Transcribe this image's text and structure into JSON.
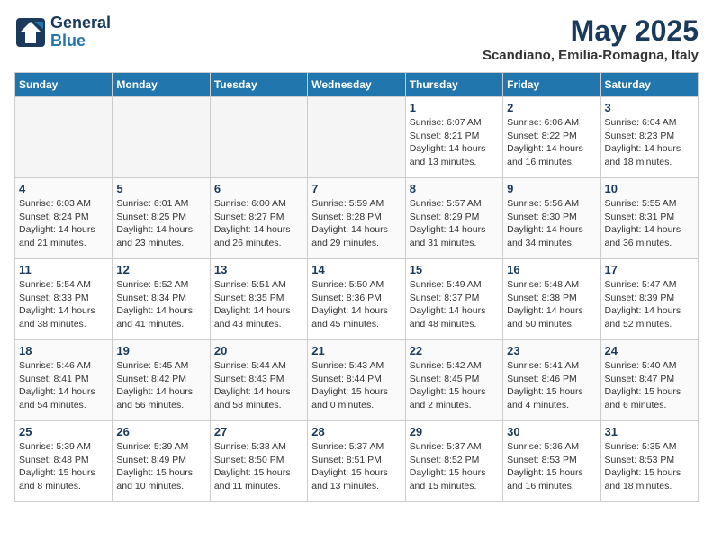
{
  "header": {
    "logo_line1": "General",
    "logo_line2": "Blue",
    "month": "May 2025",
    "location": "Scandiano, Emilia-Romagna, Italy"
  },
  "weekdays": [
    "Sunday",
    "Monday",
    "Tuesday",
    "Wednesday",
    "Thursday",
    "Friday",
    "Saturday"
  ],
  "weeks": [
    [
      {
        "day": "",
        "info": "",
        "empty": true
      },
      {
        "day": "",
        "info": "",
        "empty": true
      },
      {
        "day": "",
        "info": "",
        "empty": true
      },
      {
        "day": "",
        "info": "",
        "empty": true
      },
      {
        "day": "1",
        "info": "Sunrise: 6:07 AM\nSunset: 8:21 PM\nDaylight: 14 hours\nand 13 minutes.",
        "empty": false
      },
      {
        "day": "2",
        "info": "Sunrise: 6:06 AM\nSunset: 8:22 PM\nDaylight: 14 hours\nand 16 minutes.",
        "empty": false
      },
      {
        "day": "3",
        "info": "Sunrise: 6:04 AM\nSunset: 8:23 PM\nDaylight: 14 hours\nand 18 minutes.",
        "empty": false
      }
    ],
    [
      {
        "day": "4",
        "info": "Sunrise: 6:03 AM\nSunset: 8:24 PM\nDaylight: 14 hours\nand 21 minutes.",
        "empty": false
      },
      {
        "day": "5",
        "info": "Sunrise: 6:01 AM\nSunset: 8:25 PM\nDaylight: 14 hours\nand 23 minutes.",
        "empty": false
      },
      {
        "day": "6",
        "info": "Sunrise: 6:00 AM\nSunset: 8:27 PM\nDaylight: 14 hours\nand 26 minutes.",
        "empty": false
      },
      {
        "day": "7",
        "info": "Sunrise: 5:59 AM\nSunset: 8:28 PM\nDaylight: 14 hours\nand 29 minutes.",
        "empty": false
      },
      {
        "day": "8",
        "info": "Sunrise: 5:57 AM\nSunset: 8:29 PM\nDaylight: 14 hours\nand 31 minutes.",
        "empty": false
      },
      {
        "day": "9",
        "info": "Sunrise: 5:56 AM\nSunset: 8:30 PM\nDaylight: 14 hours\nand 34 minutes.",
        "empty": false
      },
      {
        "day": "10",
        "info": "Sunrise: 5:55 AM\nSunset: 8:31 PM\nDaylight: 14 hours\nand 36 minutes.",
        "empty": false
      }
    ],
    [
      {
        "day": "11",
        "info": "Sunrise: 5:54 AM\nSunset: 8:33 PM\nDaylight: 14 hours\nand 38 minutes.",
        "empty": false
      },
      {
        "day": "12",
        "info": "Sunrise: 5:52 AM\nSunset: 8:34 PM\nDaylight: 14 hours\nand 41 minutes.",
        "empty": false
      },
      {
        "day": "13",
        "info": "Sunrise: 5:51 AM\nSunset: 8:35 PM\nDaylight: 14 hours\nand 43 minutes.",
        "empty": false
      },
      {
        "day": "14",
        "info": "Sunrise: 5:50 AM\nSunset: 8:36 PM\nDaylight: 14 hours\nand 45 minutes.",
        "empty": false
      },
      {
        "day": "15",
        "info": "Sunrise: 5:49 AM\nSunset: 8:37 PM\nDaylight: 14 hours\nand 48 minutes.",
        "empty": false
      },
      {
        "day": "16",
        "info": "Sunrise: 5:48 AM\nSunset: 8:38 PM\nDaylight: 14 hours\nand 50 minutes.",
        "empty": false
      },
      {
        "day": "17",
        "info": "Sunrise: 5:47 AM\nSunset: 8:39 PM\nDaylight: 14 hours\nand 52 minutes.",
        "empty": false
      }
    ],
    [
      {
        "day": "18",
        "info": "Sunrise: 5:46 AM\nSunset: 8:41 PM\nDaylight: 14 hours\nand 54 minutes.",
        "empty": false
      },
      {
        "day": "19",
        "info": "Sunrise: 5:45 AM\nSunset: 8:42 PM\nDaylight: 14 hours\nand 56 minutes.",
        "empty": false
      },
      {
        "day": "20",
        "info": "Sunrise: 5:44 AM\nSunset: 8:43 PM\nDaylight: 14 hours\nand 58 minutes.",
        "empty": false
      },
      {
        "day": "21",
        "info": "Sunrise: 5:43 AM\nSunset: 8:44 PM\nDaylight: 15 hours\nand 0 minutes.",
        "empty": false
      },
      {
        "day": "22",
        "info": "Sunrise: 5:42 AM\nSunset: 8:45 PM\nDaylight: 15 hours\nand 2 minutes.",
        "empty": false
      },
      {
        "day": "23",
        "info": "Sunrise: 5:41 AM\nSunset: 8:46 PM\nDaylight: 15 hours\nand 4 minutes.",
        "empty": false
      },
      {
        "day": "24",
        "info": "Sunrise: 5:40 AM\nSunset: 8:47 PM\nDaylight: 15 hours\nand 6 minutes.",
        "empty": false
      }
    ],
    [
      {
        "day": "25",
        "info": "Sunrise: 5:39 AM\nSunset: 8:48 PM\nDaylight: 15 hours\nand 8 minutes.",
        "empty": false
      },
      {
        "day": "26",
        "info": "Sunrise: 5:39 AM\nSunset: 8:49 PM\nDaylight: 15 hours\nand 10 minutes.",
        "empty": false
      },
      {
        "day": "27",
        "info": "Sunrise: 5:38 AM\nSunset: 8:50 PM\nDaylight: 15 hours\nand 11 minutes.",
        "empty": false
      },
      {
        "day": "28",
        "info": "Sunrise: 5:37 AM\nSunset: 8:51 PM\nDaylight: 15 hours\nand 13 minutes.",
        "empty": false
      },
      {
        "day": "29",
        "info": "Sunrise: 5:37 AM\nSunset: 8:52 PM\nDaylight: 15 hours\nand 15 minutes.",
        "empty": false
      },
      {
        "day": "30",
        "info": "Sunrise: 5:36 AM\nSunset: 8:53 PM\nDaylight: 15 hours\nand 16 minutes.",
        "empty": false
      },
      {
        "day": "31",
        "info": "Sunrise: 5:35 AM\nSunset: 8:53 PM\nDaylight: 15 hours\nand 18 minutes.",
        "empty": false
      }
    ]
  ]
}
